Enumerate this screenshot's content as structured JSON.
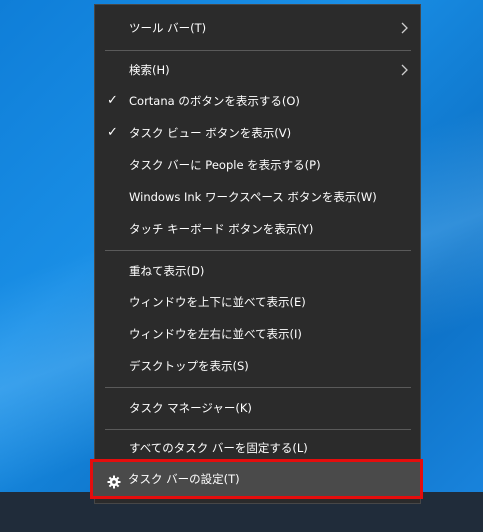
{
  "menu": {
    "items": [
      {
        "label": "ツール バー(T)",
        "submenu": true,
        "checked": false
      },
      {
        "label": "検索(H)",
        "submenu": true,
        "checked": false
      },
      {
        "label": "Cortana のボタンを表示する(O)",
        "checked": true
      },
      {
        "label": "タスク ビュー ボタンを表示(V)",
        "checked": true
      },
      {
        "label": "タスク バーに People を表示する(P)",
        "checked": false
      },
      {
        "label": "Windows Ink ワークスペース ボタンを表示(W)",
        "checked": false
      },
      {
        "label": "タッチ キーボード ボタンを表示(Y)",
        "checked": false
      },
      {
        "label": "重ねて表示(D)",
        "checked": false
      },
      {
        "label": "ウィンドウを上下に並べて表示(E)",
        "checked": false
      },
      {
        "label": "ウィンドウを左右に並べて表示(I)",
        "checked": false
      },
      {
        "label": "デスクトップを表示(S)",
        "checked": false
      },
      {
        "label": "タスク マネージャー(K)",
        "checked": false
      },
      {
        "label": "すべてのタスク バーを固定する(L)",
        "checked": false
      },
      {
        "label": "タスク バーの設定(T)",
        "icon": "gear-icon",
        "highlighted": true
      }
    ]
  },
  "colors": {
    "menu_bg": "#2b2b2b",
    "highlight_border": "#e50d0d",
    "text": "#ffffff"
  }
}
